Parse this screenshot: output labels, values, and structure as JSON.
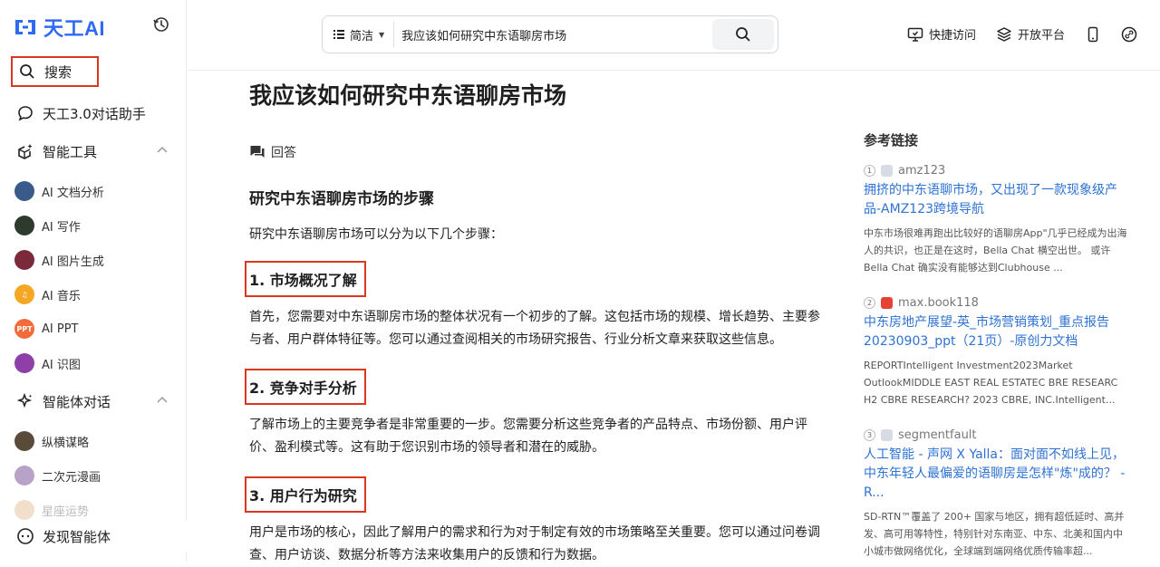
{
  "brand": {
    "logo_text": "天工AI",
    "accent": "#2e6bf2"
  },
  "sidebar": {
    "search": "搜索",
    "assistant": "天工3.0对话助手",
    "tools_section": "智能工具",
    "tools": [
      {
        "label": "AI 文档分析",
        "color": "#3a5a8c"
      },
      {
        "label": "AI 写作",
        "color": "#2d3a2e"
      },
      {
        "label": "AI 图片生成",
        "color": "#7a2a3a"
      },
      {
        "label": "AI 音乐",
        "color": "#f5a623"
      },
      {
        "label": "AI PPT",
        "color": "#f26b3a"
      },
      {
        "label": "AI 识图",
        "color": "#8e3fa8"
      }
    ],
    "agents_section": "智能体对话",
    "agents": [
      {
        "label": "纵横谋略",
        "color": "#5a4a3a"
      },
      {
        "label": "二次元漫画",
        "color": "#b9a2c8"
      },
      {
        "label": "星座运势",
        "color": "#e8c8a8"
      }
    ],
    "discover": "发现智能体"
  },
  "topbar": {
    "mode": "简洁",
    "query": "我应该如何研究中东语聊房市场",
    "quick_access": "快捷访问",
    "open_platform": "开放平台"
  },
  "main": {
    "title": "我应该如何研究中东语聊房市场",
    "answer_label": "回答",
    "heading": "研究中东语聊房市场的步骤",
    "intro": "研究中东语聊房市场可以分为以下几个步骤：",
    "steps": [
      {
        "title": "1. 市场概况了解",
        "text": "首先，您需要对中东语聊房市场的整体状况有一个初步的了解。这包括市场的规模、增长趋势、主要参与者、用户群体特征等。您可以通过查阅相关的市场研究报告、行业分析文章来获取这些信息。"
      },
      {
        "title": "2. 竞争对手分析",
        "text": "了解市场上的主要竞争者是非常重要的一步。您需要分析这些竞争者的产品特点、市场份额、用户评价、盈利模式等。这有助于您识别市场的领导者和潜在的威胁。"
      },
      {
        "title": "3. 用户行为研究",
        "text": "用户是市场的核心，因此了解用户的需求和行为对于制定有效的市场策略至关重要。您可以通过问卷调查、用户访谈、数据分析等方法来收集用户的反馈和行为数据。"
      }
    ]
  },
  "refs": {
    "title": "参考链接",
    "items": [
      {
        "num": "1",
        "source": "amz123",
        "link": "拥挤的中东语聊市场，又出现了一款现象级产品-AMZ123跨境导航",
        "snippet": "中东市场很难再跑出比较好的语聊房App\"几乎已经成为出海人的共识，也正是在这时，Bella Chat 横空出世。 或许 Bella Chat 确实没有能够达到Clubhouse ..."
      },
      {
        "num": "2",
        "source": "max.book118",
        "link": "中东房地产展望-英_市场营销策划_重点报告20230903_ppt（21页）-原创力文档",
        "snippet": "REPORTIntelligent Investment2023Market OutlookMIDDLE EAST REAL ESTATEC BRE RESEARC H2 CBRE RESEARCH? 2023 CBRE, INC.Intelligent..."
      },
      {
        "num": "3",
        "source": "segmentfault",
        "link": "人工智能 - 声网 X Yalla：面对面不如线上见，中东年轻人最偏爱的语聊房是怎样\"炼\"成的？ - R...",
        "snippet": "SD-RTN™覆盖了 200+ 国家与地区，拥有超低延时、高并发、高可用等特性，特别针对东南亚、中东、北美和国内中小城市做网络优化，全球端到端网络优质传输率超..."
      }
    ]
  }
}
